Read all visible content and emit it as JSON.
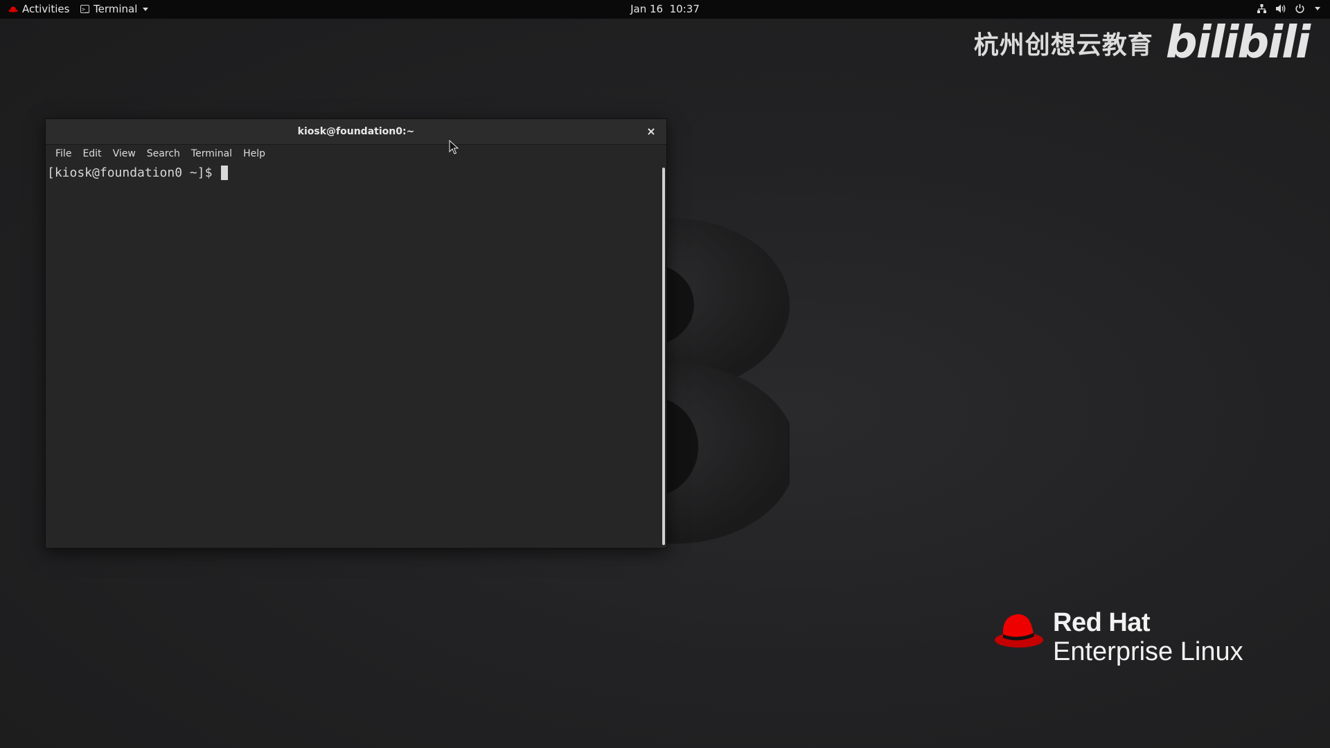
{
  "topbar": {
    "activities_label": "Activities",
    "app_menu_label": "Terminal",
    "clock_date": "Jan 16",
    "clock_time": "10:37"
  },
  "watermark": {
    "text": "杭州创想云教育",
    "logo": "bilibili"
  },
  "branding": {
    "line1": "Red Hat",
    "line2": "Enterprise Linux",
    "hat_color": "#ee0000"
  },
  "terminal": {
    "title": "kiosk@foundation0:~",
    "close_glyph": "×",
    "menu": [
      "File",
      "Edit",
      "View",
      "Search",
      "Terminal",
      "Help"
    ],
    "prompt": "[kiosk@foundation0 ~]$ "
  },
  "icons": {
    "activities": "redhat-hat-icon",
    "app_menu": "terminal-icon",
    "network": "network-icon",
    "volume": "volume-icon",
    "power": "power-icon",
    "menu_caret": "chevron-down-icon"
  },
  "colors": {
    "topbar_bg": "#0a0a0a",
    "desktop_bg": "#222224",
    "terminal_bg": "#262626",
    "accent_red": "#ee0000"
  }
}
